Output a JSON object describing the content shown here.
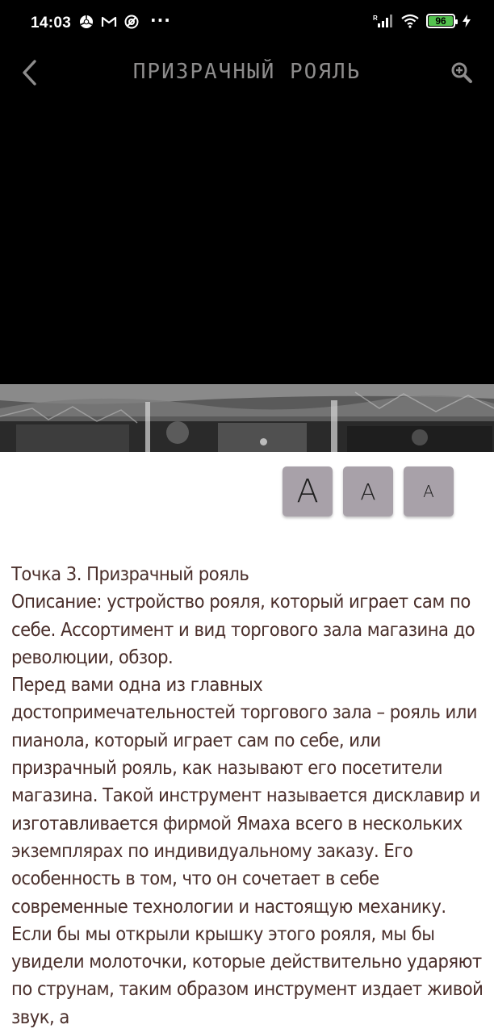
{
  "status_bar": {
    "time": "14:03",
    "more": "···",
    "battery": "96",
    "signal_label": "R"
  },
  "app_bar": {
    "title": "Призрачный рояль"
  },
  "font_buttons": {
    "large": "А",
    "medium": "А",
    "small": "А"
  },
  "content": {
    "heading": "Точка 3. Призрачный рояль",
    "description": "Описание: устройство рояля, который играет сам по себе. Ассортимент и вид торгового зала магазина до революции, обзор.",
    "body": "Перед вами одна из главных достопримечательностей торгового зала – рояль или пианола, который играет сам по себе, или призрачный рояль, как называют его посетители магазина. Такой инструмент называется дисклавир и изготавливается фирмой Ямаха всего в нескольких экземплярах по индивидуальному заказу. Его особенность в том, что он сочетает в себе современные технологии и настоящую механику. Если бы мы открыли крышку этого рояля, мы бы увидели молоточки, которые действительно ударяют по струнам, таким образом инструмент издает живой звук, а"
  },
  "colors": {
    "header_bg": "#000000",
    "title": "#8d8c8c",
    "font_button_bg": "#a8a1a9",
    "text": "#4a2f2b",
    "battery": "#54c24f"
  }
}
